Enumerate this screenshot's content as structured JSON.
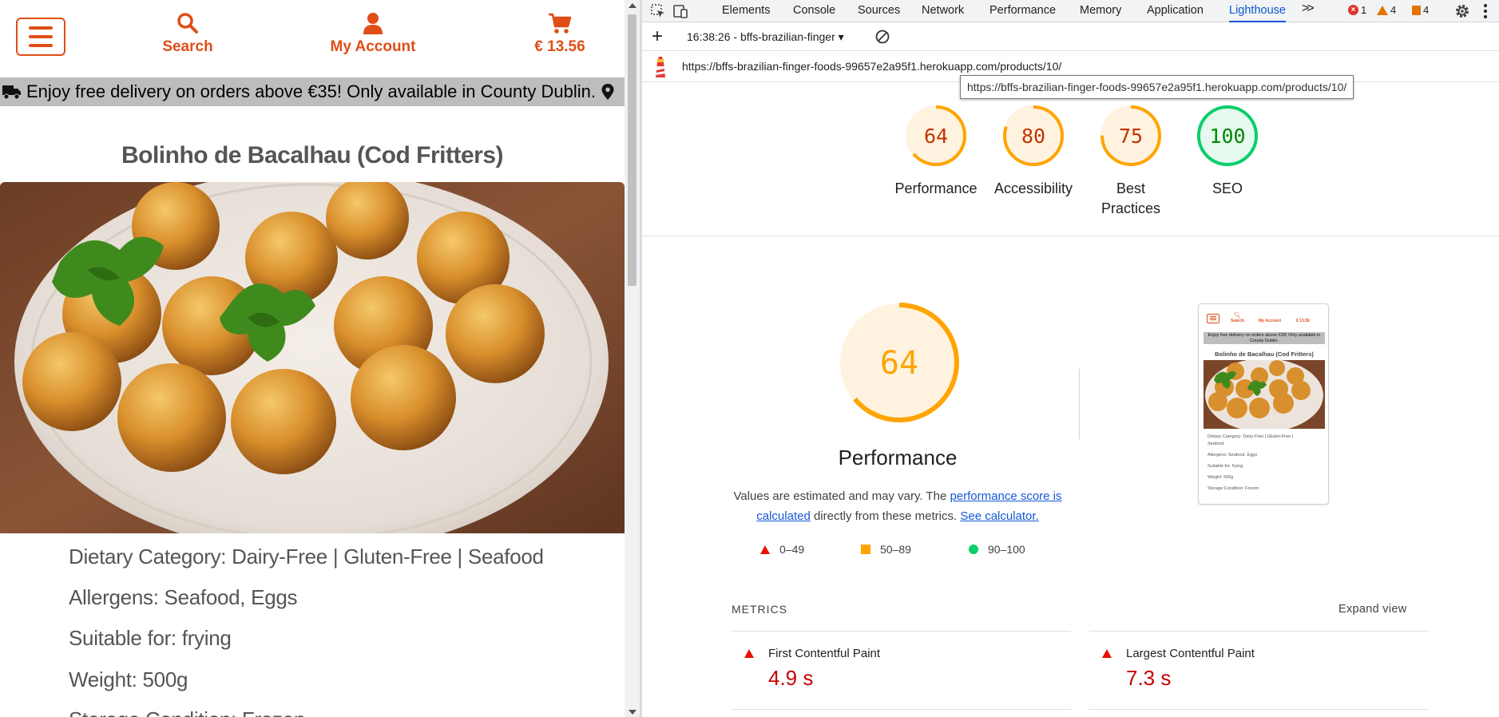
{
  "site": {
    "nav": {
      "search_label": "Search",
      "account_label": "My Account",
      "cart_total": "€ 13.56"
    },
    "banner_text": "Enjoy free delivery on orders above €35! Only available in County Dublin.",
    "product": {
      "title": "Bolinho de Bacalhau (Cod Fritters)",
      "dietary": "Dietary Category: Dairy-Free | Gluten-Free | Seafood",
      "allergens": "Allergens: Seafood, Eggs",
      "suitable": "Suitable for: frying",
      "weight": "Weight: 500g",
      "storage": "Storage Condition: Frozen"
    },
    "colors": {
      "accent": "#e04e17",
      "banner_bg": "#bdbdbd"
    }
  },
  "devtools": {
    "tabs": [
      "Elements",
      "Console",
      "Sources",
      "Network",
      "Performance",
      "Memory",
      "Application",
      "Lighthouse"
    ],
    "active_tab": "Lighthouse",
    "badges": {
      "errors": "1",
      "warnings": "4",
      "issues": "4"
    },
    "report_select": "16:38:26 - bffs-brazilian-finger",
    "url": "https://bffs-brazilian-finger-foods-99657e2a95f1.herokuapp.com/products/10/",
    "tooltip": "https://bffs-brazilian-finger-foods-99657e2a95f1.herokuapp.com/products/10/",
    "scores": [
      {
        "label": "Performance",
        "value": 64,
        "color": "#e65100",
        "ring": "#ffa400",
        "bg": "#fff3e0"
      },
      {
        "label": "Accessibility",
        "value": 80,
        "color": "#c33300",
        "ring": "#ffa400",
        "bg": "#fff3e0"
      },
      {
        "label_line1": "Best",
        "label_line2": "Practices",
        "value": 75,
        "color": "#c33300",
        "ring": "#ffa400",
        "bg": "#fff3e0"
      },
      {
        "label": "SEO",
        "value": 100,
        "color": "#008800",
        "ring": "#0cce6b",
        "bg": "#e6f9ee"
      }
    ],
    "performance": {
      "score": 64,
      "title": "Performance",
      "desc_prefix": "Values are estimated and may vary. The ",
      "desc_link1": "performance score is calculated",
      "desc_middle": " directly from these metrics. ",
      "desc_link2": "See calculator."
    },
    "legend": [
      "0–49",
      "50–89",
      "90–100"
    ],
    "thumb": {
      "search": "Search",
      "account": "My Account",
      "cart": "€ 13.56",
      "banner": "Enjoy free delivery on orders above €35! Only available in County Dublin.",
      "title": "Bolinho de Bacalhau (Cod Fritters)",
      "dietary_1": "Dietary Category: Dairy-Free | Gluten-Free |",
      "dietary_2": "Seafood",
      "allergens": "Allergens: Seafood, Eggs",
      "suitable": "Suitable for: frying",
      "weight": "Weight: 500g",
      "storage": "Storage Condition: Frozen"
    },
    "metrics": {
      "heading": "METRICS",
      "expand": "Expand view",
      "items": [
        {
          "name": "First Contentful Paint",
          "value": "4.9 s"
        },
        {
          "name": "Largest Contentful Paint",
          "value": "7.3 s"
        }
      ]
    }
  }
}
